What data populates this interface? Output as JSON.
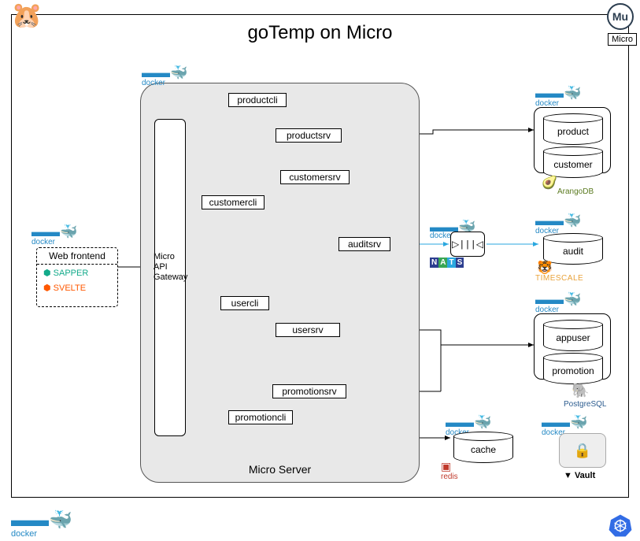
{
  "title": "goTemp on Micro",
  "corner": {
    "mu": "Mu",
    "micro": "Micro"
  },
  "frontend": {
    "header": "Web frontend",
    "sapper": "SAPPER",
    "svelte": "SVELTE",
    "docker": "docker"
  },
  "gateway": "Micro\nAPI\nGateway",
  "microServerLabel": "Micro Server",
  "clis": {
    "product": "productcli",
    "customer": "customercli",
    "user": "usercli",
    "promotion": "promotioncli"
  },
  "srvs": {
    "product": "productsrv",
    "customer": "customersrv",
    "audit": "auditsrv",
    "user": "usersrv",
    "promotion": "promotionsrv"
  },
  "dbs": {
    "product": "product",
    "customer": "customer",
    "audit": "audit",
    "appuser": "appuser",
    "promotion": "promotion",
    "cache": "cache"
  },
  "stacks": {
    "arango": "ArangoDB",
    "nats": "NATS",
    "timescale": "TIMESCALE",
    "redis": "redis",
    "postgres": "PostgreSQL",
    "vault": "Vault"
  },
  "dockerLabel": "docker",
  "natsGlyph": "▷|||◁"
}
